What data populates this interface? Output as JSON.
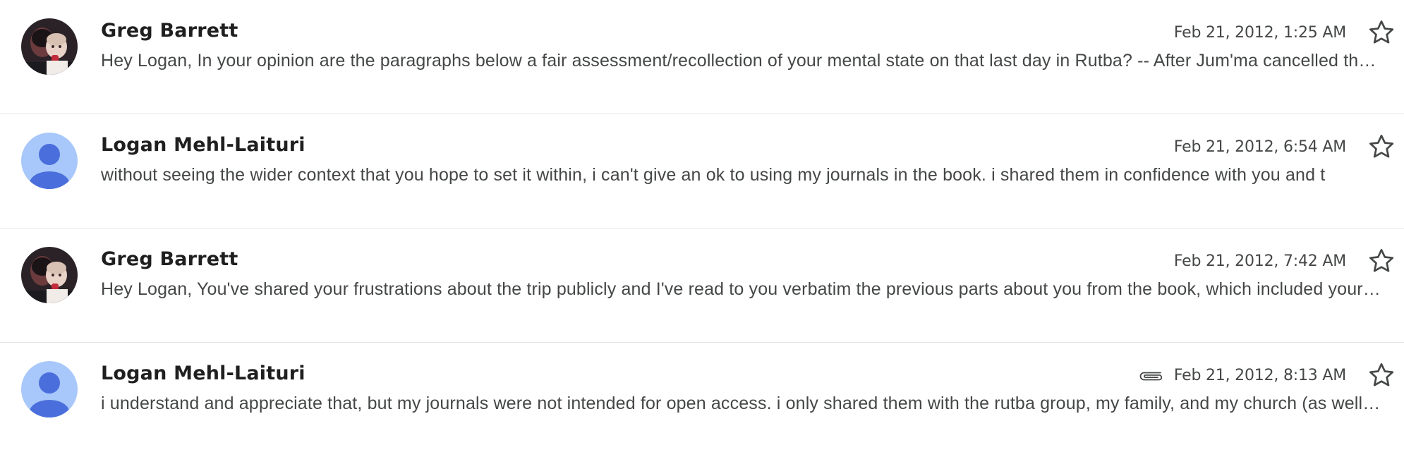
{
  "messages": [
    {
      "sender": "Greg Barrett",
      "avatar": "photo-avatar",
      "date": "Feb 21, 2012, 1:25 AM",
      "has_attachment": false,
      "snippet": "Hey Logan, In your opinion are the paragraphs below a fair assessment/recollection of your mental state on that last day in Rutba? -- After Jum'ma cancelled the trip"
    },
    {
      "sender": "Logan Mehl-Laituri",
      "avatar": "default-person-avatar",
      "date": "Feb 21, 2012, 6:54 AM",
      "has_attachment": false,
      "snippet": "without seeing the wider context that you hope to set it within, i can't give an ok to using my journals in the book. i shared them in confidence with you and t"
    },
    {
      "sender": "Greg Barrett",
      "avatar": "photo-avatar",
      "date": "Feb 21, 2012, 7:42 AM",
      "has_attachment": false,
      "snippet": "Hey Logan, You've shared your frustrations about the trip publicly and I've read to you verbatim the previous parts about you from the book, which included your account"
    },
    {
      "sender": "Logan Mehl-Laituri",
      "avatar": "default-person-avatar",
      "date": "Feb 21, 2012, 8:13 AM",
      "has_attachment": true,
      "snippet": "i understand and appreciate that, but my journals were not intended for open access. i only shared them with the rutba group, my family, and my church (as well as others)"
    }
  ],
  "icons": {
    "star": "star-outline-icon",
    "attachment": "paperclip-icon"
  },
  "colors": {
    "default_avatar_bg": "#a8c7fa",
    "default_avatar_fg": "#4a6fdc",
    "divider": "#e6e6e6",
    "sender_text": "#1f1f1f",
    "secondary_text": "#444746"
  }
}
